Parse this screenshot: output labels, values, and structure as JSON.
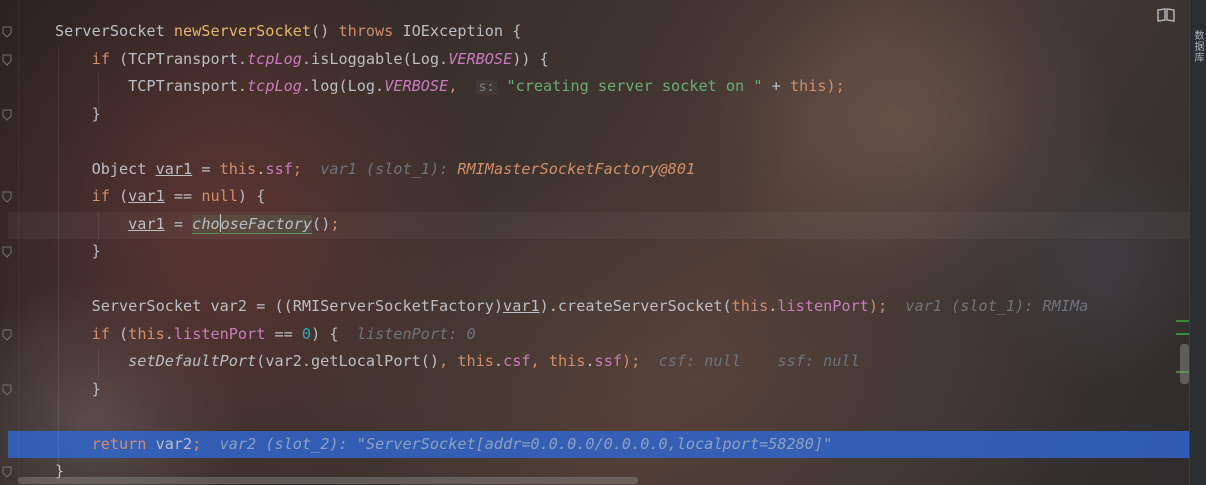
{
  "sidebar_right": {
    "label": "数据库"
  },
  "code": {
    "lines": [
      {
        "segments": [
          {
            "t": "ServerSocket ",
            "c": ""
          },
          {
            "t": "newServerSocket",
            "c": "fnDecl"
          },
          {
            "t": "() ",
            "c": ""
          },
          {
            "t": "throws",
            "c": "kw"
          },
          {
            "t": " IOException {",
            "c": ""
          }
        ]
      },
      {
        "segments": [
          {
            "t": "    ",
            "c": ""
          },
          {
            "t": "if",
            "c": "kw"
          },
          {
            "t": " (TCPTransport.",
            "c": ""
          },
          {
            "t": "tcpLog",
            "c": "stat"
          },
          {
            "t": ".isLoggable(Log.",
            "c": ""
          },
          {
            "t": "VERBOSE",
            "c": "stat"
          },
          {
            "t": ")) {",
            "c": ""
          }
        ]
      },
      {
        "segments": [
          {
            "t": "        TCPTransport.",
            "c": ""
          },
          {
            "t": "tcpLog",
            "c": "stat"
          },
          {
            "t": ".log(Log.",
            "c": ""
          },
          {
            "t": "VERBOSE",
            "c": "stat"
          },
          {
            "t": ",  ",
            "c": "kw"
          },
          {
            "t": "s:",
            "c": "phint"
          },
          {
            "t": " ",
            "c": ""
          },
          {
            "t": "\"creating server socket on \"",
            "c": "str"
          },
          {
            "t": " + ",
            "c": ""
          },
          {
            "t": "this",
            "c": "kw"
          },
          {
            "t": ");",
            "c": "kw"
          }
        ]
      },
      {
        "segments": [
          {
            "t": "    }",
            "c": ""
          }
        ]
      },
      {
        "segments": []
      },
      {
        "segments": [
          {
            "t": "    Object ",
            "c": ""
          },
          {
            "t": "var1",
            "c": "ul"
          },
          {
            "t": " = ",
            "c": ""
          },
          {
            "t": "this",
            "c": "kw"
          },
          {
            "t": ".",
            "c": ""
          },
          {
            "t": "ssf",
            "c": "fld"
          },
          {
            "t": ";  ",
            "c": "kw"
          },
          {
            "t": "var1 (slot_1): ",
            "c": "hint"
          },
          {
            "t": "RMIMasterSocketFactory@801",
            "c": "hintv"
          }
        ]
      },
      {
        "segments": [
          {
            "t": "    ",
            "c": ""
          },
          {
            "t": "if",
            "c": "kw"
          },
          {
            "t": " (",
            "c": ""
          },
          {
            "t": "var1",
            "c": "ul"
          },
          {
            "t": " == ",
            "c": ""
          },
          {
            "t": "null",
            "c": "kw"
          },
          {
            "t": ") {",
            "c": ""
          }
        ]
      },
      {
        "segments": [
          {
            "t": "        ",
            "c": ""
          },
          {
            "t": "var1",
            "c": "ul"
          },
          {
            "t": " = ",
            "c": ""
          },
          {
            "t": "cho",
            "c": "statfn factbox"
          },
          {
            "t": "CARET",
            "c": "caret"
          },
          {
            "t": "oseFactory",
            "c": "statfn factbox"
          },
          {
            "t": "()",
            "c": ""
          },
          {
            "t": ";",
            "c": "kw"
          }
        ]
      },
      {
        "segments": [
          {
            "t": "    }",
            "c": ""
          }
        ]
      },
      {
        "segments": []
      },
      {
        "segments": [
          {
            "t": "    ServerSocket var2 = ((RMIServerSocketFactory)",
            "c": ""
          },
          {
            "t": "var1",
            "c": "ul"
          },
          {
            "t": ").createServerSocket(",
            "c": ""
          },
          {
            "t": "this",
            "c": "kw"
          },
          {
            "t": ".",
            "c": ""
          },
          {
            "t": "listenPort",
            "c": "fld"
          },
          {
            "t": ");  ",
            "c": "kw"
          },
          {
            "t": "var1 (slot_1): RMIMa",
            "c": "hint"
          }
        ]
      },
      {
        "segments": [
          {
            "t": "    ",
            "c": ""
          },
          {
            "t": "if",
            "c": "kw"
          },
          {
            "t": " (",
            "c": ""
          },
          {
            "t": "this",
            "c": "kw"
          },
          {
            "t": ".",
            "c": ""
          },
          {
            "t": "listenPort",
            "c": "fld"
          },
          {
            "t": " == ",
            "c": ""
          },
          {
            "t": "0",
            "c": "num"
          },
          {
            "t": ") {  ",
            "c": ""
          },
          {
            "t": "listenPort: 0",
            "c": "hint"
          }
        ]
      },
      {
        "segments": [
          {
            "t": "        ",
            "c": ""
          },
          {
            "t": "setDefaultPort",
            "c": "statfn"
          },
          {
            "t": "(var2.getLocalPort()",
            "c": ""
          },
          {
            "t": ", ",
            "c": "kw"
          },
          {
            "t": "this",
            "c": "kw"
          },
          {
            "t": ".",
            "c": ""
          },
          {
            "t": "csf",
            "c": "fld"
          },
          {
            "t": ", ",
            "c": "kw"
          },
          {
            "t": "this",
            "c": "kw"
          },
          {
            "t": ".",
            "c": ""
          },
          {
            "t": "ssf",
            "c": "fld"
          },
          {
            "t": ");  ",
            "c": "kw"
          },
          {
            "t": "csf: null    ssf: null",
            "c": "hint"
          }
        ]
      },
      {
        "segments": [
          {
            "t": "    }",
            "c": ""
          }
        ]
      },
      {
        "segments": []
      },
      {
        "segments": [
          {
            "t": "    ",
            "c": ""
          },
          {
            "t": "return",
            "c": "kw"
          },
          {
            "t": " var2",
            "c": ""
          },
          {
            "t": ";  ",
            "c": "kw"
          },
          {
            "t": "var2 (slot_2): ",
            "c": "sel-hint"
          },
          {
            "t": "\"ServerSocket[addr=0.0.0.0/0.0.0.0,localport=58280]\"",
            "c": "sel-str"
          }
        ]
      },
      {
        "segments": [
          {
            "t": "}",
            "c": ""
          }
        ]
      }
    ]
  }
}
